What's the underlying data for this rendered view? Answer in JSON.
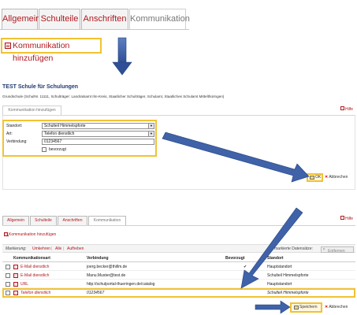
{
  "top": {
    "tabs": [
      {
        "label": "Allgemein",
        "active": false
      },
      {
        "label": "Schulteile",
        "active": false
      },
      {
        "label": "Anschriften",
        "active": false
      },
      {
        "label": "Kommunikation",
        "active": true
      }
    ],
    "add_link": "Kommunikation hinzufügen"
  },
  "dialog": {
    "school_title": "TEST Schule für Schulungen",
    "school_sub": "Grundschule (SchulNr. 11111, Schulträger: Landratsamt Ilm-Kreis, Staatlicher Schulträger, Schulamt, Staatliches Schulamt Mittelthüringen)",
    "help": "Hilfe",
    "tab": "Kommunikation hinzufügen",
    "standort_label": "Standort:",
    "standort_value": "Schulteil Himmelspforte",
    "art_label": "Art:",
    "art_value": "Telefon dienstlich",
    "verbindung_label": "Verbindung:",
    "verbindung_value": "01234567",
    "bevorzugt_label": "bevorzugt",
    "ok": "OK",
    "cancel": "Abbrechen"
  },
  "list": {
    "tabs": [
      {
        "label": "Allgemein",
        "active": false
      },
      {
        "label": "Schulteile",
        "active": false
      },
      {
        "label": "Anschriften",
        "active": false
      },
      {
        "label": "Kommunikation",
        "active": true
      }
    ],
    "help": "Hilfe",
    "add_link": "Kommunikation hinzufügen",
    "markierung": "Markierung:",
    "umkehren": "Umkehren",
    "alle": "Alle",
    "aufheben": "Aufheben",
    "marked_label": "markierte Datensätze:",
    "entfernen": "Entfernen",
    "columns": [
      "Kommunikationsart",
      "Verbindung",
      "Bevorzugt",
      "Standort"
    ],
    "rows": [
      {
        "art": "E-Mail dienstlich",
        "verbindung": "joerg.becker@thillm.de",
        "bevorzugt": "✔",
        "standort": "Hauptstandort"
      },
      {
        "art": "E-Mail dienstlich",
        "verbindung": "Manu.Muster@test.de",
        "bevorzugt": "",
        "standort": "Schulteil Himmelspforte"
      },
      {
        "art": "URL",
        "verbindung": "http://schulportal-thueringen.de/catalog",
        "bevorzugt": "",
        "standort": "Hauptstandort"
      },
      {
        "art": "Telefon dienstlich",
        "verbindung": "01234567",
        "bevorzugt": "",
        "standort": "Schulteil Himmelspforte"
      }
    ],
    "save": "Speichern",
    "cancel": "Abbrechen"
  },
  "colors": {
    "accent_red": "#b0181e",
    "highlight_yellow": "#f1c232",
    "arrow_blue": "#2f4f96"
  }
}
